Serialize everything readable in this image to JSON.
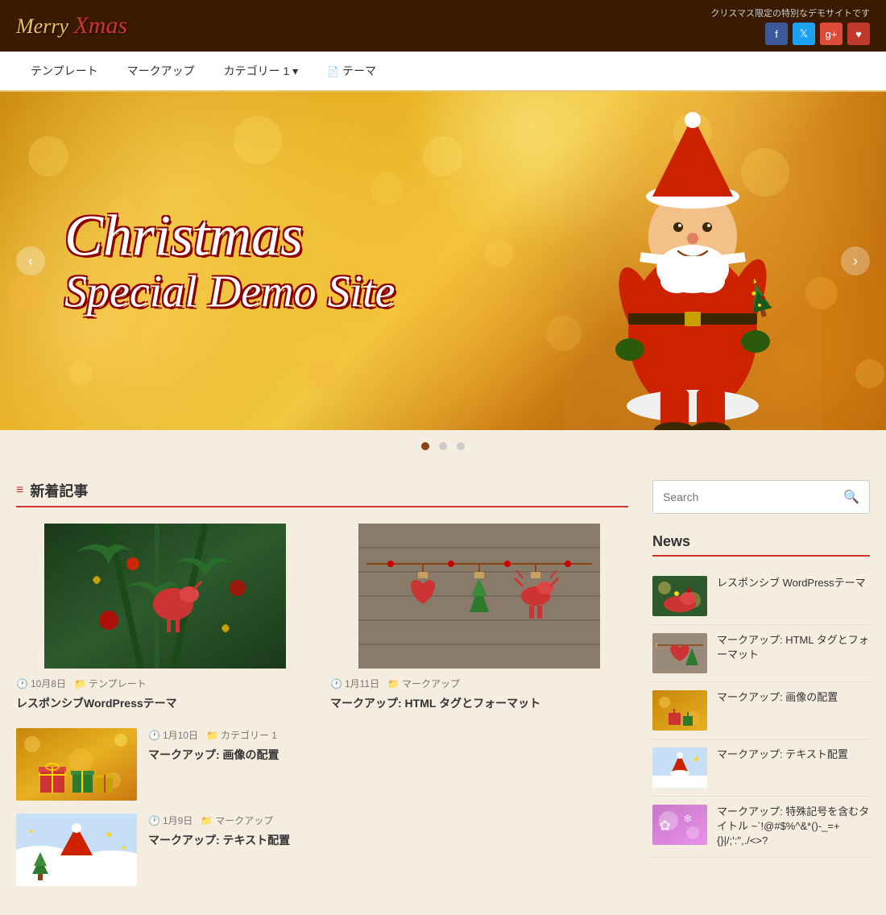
{
  "site": {
    "logo": "Merry Xmas",
    "tagline": "クリスマス限定の特別なデモサイトです"
  },
  "social": {
    "facebook": "f",
    "twitter": "t",
    "googleplus": "g+",
    "heart": "♥"
  },
  "nav": {
    "items": [
      {
        "label": "テンプレート",
        "href": "#",
        "dropdown": false
      },
      {
        "label": "マークアップ",
        "href": "#",
        "dropdown": false
      },
      {
        "label": "カテゴリー 1",
        "href": "#",
        "dropdown": true
      },
      {
        "label": "テーマ",
        "href": "#",
        "dropdown": false
      }
    ]
  },
  "hero": {
    "line1": "Christmas",
    "line2": "Special Demo Site",
    "prev_label": "‹",
    "next_label": "›"
  },
  "slider_dots": [
    {
      "active": true
    },
    {
      "active": false
    },
    {
      "active": false
    }
  ],
  "new_articles": {
    "section_title": "新着記事"
  },
  "articles": [
    {
      "date": "10月8日",
      "category": "テンプレート",
      "title": "レスポンシブWordPressテーマ",
      "thumb_class": "thumb-ornament"
    },
    {
      "date": "1月11日",
      "category": "マークアップ",
      "title": "マークアップ: HTML タグとフォーマット",
      "thumb_class": "thumb-red-decor"
    }
  ],
  "articles_list": [
    {
      "date": "1月10日",
      "category": "カテゴリー 1",
      "title": "マークアップ: 画像の配置",
      "thumb_class": "thumb-gold-gifts"
    },
    {
      "date": "1月9日",
      "category": "マークアップ",
      "title": "マークアップ: テキスト配置",
      "thumb_class": "thumb-santa-small"
    }
  ],
  "sidebar": {
    "search": {
      "placeholder": "Search",
      "button_label": "🔍"
    },
    "news": {
      "section_title": "News",
      "items": [
        {
          "title": "レスポンシブ WordPressテーマ",
          "thumb_class": "thumb-ornament"
        },
        {
          "title": "マークアップ: HTML タグとフォーマット",
          "thumb_class": "thumb-red-decor"
        },
        {
          "title": "マークアップ: 画像の配置",
          "thumb_class": "thumb-gold-gifts"
        },
        {
          "title": "マークアップ: テキスト配置",
          "thumb_class": "thumb-santa-small"
        },
        {
          "title": "マークアップ: 特殊記号を含むタイトル ~`!@#$%^&*()-_=+{}|/;':\",./<>?",
          "thumb_class": "thumb-special"
        }
      ]
    }
  }
}
